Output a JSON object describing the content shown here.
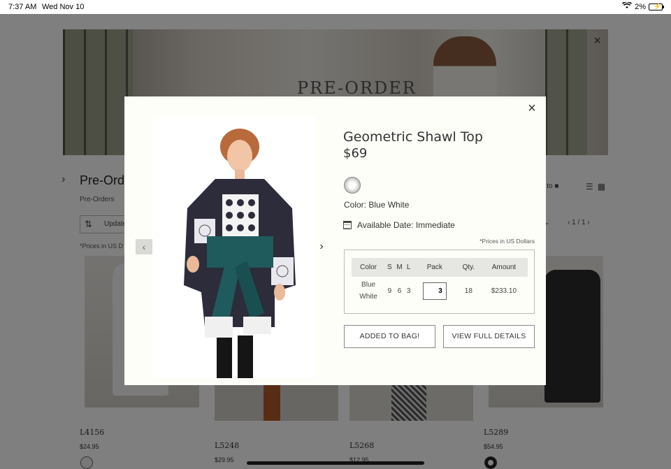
{
  "status_bar": {
    "time": "7:37 AM",
    "date": "Wed Nov 10",
    "battery": "2%"
  },
  "background": {
    "banner_title": "PRE-ORDER",
    "section_title": "Pre-Order",
    "breadcrumb": "Pre-Orders",
    "sort_label": "Update",
    "prices_note": "*Prices in US D",
    "add_all_label": "ll to",
    "pager": "1 / 1",
    "products": [
      {
        "name": "L4156",
        "price": "$24.95"
      },
      {
        "name": "L5248",
        "price": "$29.95"
      },
      {
        "name": "L5268",
        "price": "$12.95"
      },
      {
        "name": "L5289",
        "price": "$54.95"
      }
    ]
  },
  "modal": {
    "title": "Geometric Shawl Top",
    "price": "$69",
    "swatch_icon": "blue-white-swatch",
    "color_line": "Color: Blue White",
    "available_line": "Available Date: Immediate",
    "prices_note": "*Prices in US Dollars",
    "table": {
      "headers": [
        "Color",
        "S",
        "M",
        "L",
        "Pack",
        "Qty.",
        "Amount"
      ],
      "row": {
        "color_line1": "Blue",
        "color_line2": "White",
        "s": "9",
        "m": "6",
        "l": "3",
        "pack": "3",
        "qty": "18",
        "amount": "$233.10"
      }
    },
    "buttons": {
      "added": "ADDED TO BAG!",
      "details": "VIEW FULL DETAILS"
    },
    "close_icon": "×",
    "prev_icon": "‹",
    "next_icon": "›"
  }
}
